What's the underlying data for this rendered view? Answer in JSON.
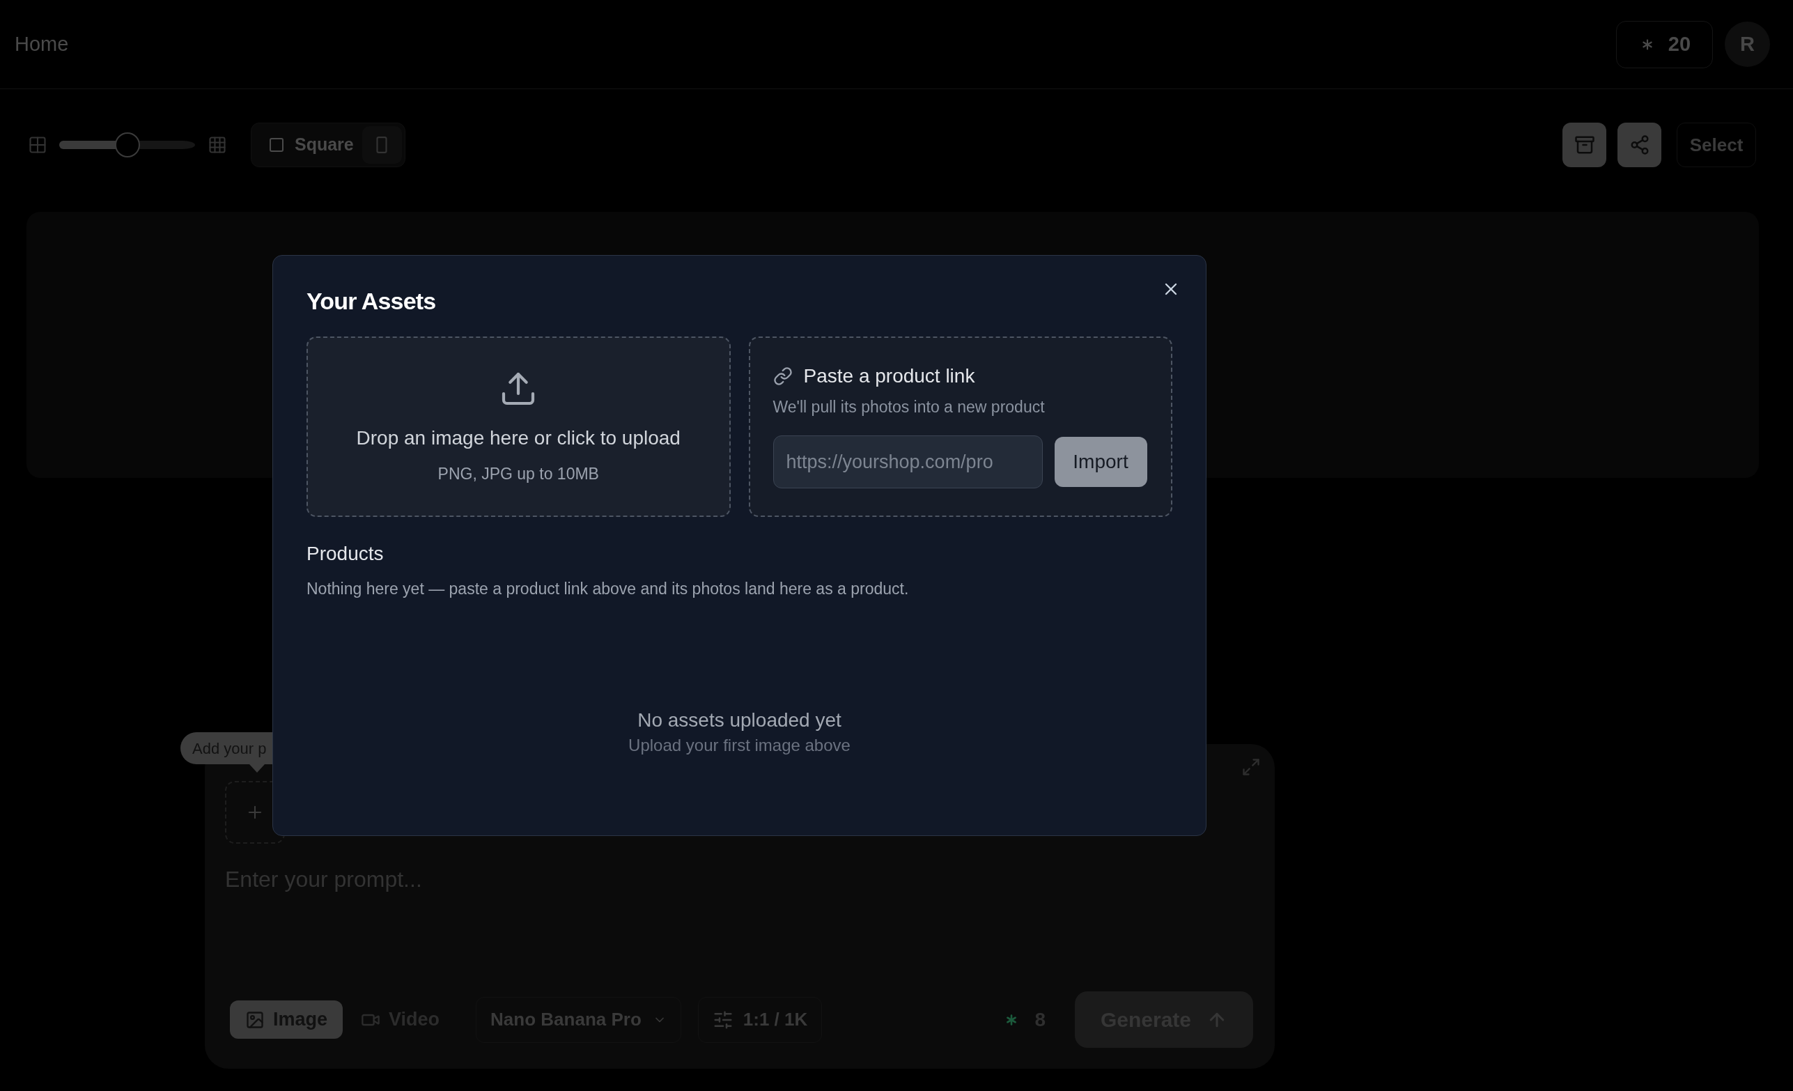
{
  "header": {
    "title": "Home",
    "credits": "20",
    "avatar_initial": "R"
  },
  "toolbar": {
    "zoom_slider": {
      "level": 0.5
    },
    "aspect_button": "Square",
    "select_button": "Select"
  },
  "prompt_panel": {
    "tooltip": "Add your p",
    "prompt_input": {
      "placeholder": "Enter your prompt..."
    },
    "modes": [
      {
        "kind": "image",
        "label": "Image",
        "selected": true
      },
      {
        "kind": "video",
        "label": "Video",
        "selected": false
      }
    ],
    "model": "Nano Banana Pro",
    "settings": "1:1 / 1K",
    "cost": "8",
    "generate_button": "Generate"
  },
  "dialog": {
    "title": "Your Assets",
    "upload": {
      "text": "Drop an image here or click to upload",
      "hint": "PNG, JPG up to 10MB"
    },
    "link_import": {
      "title": "Paste a product link",
      "subtitle": "We'll pull its photos into a new product",
      "url_input": {
        "placeholder": "https://yourshop.com/pro"
      },
      "button": "Import"
    },
    "products": {
      "title": "Products",
      "empty_text": "Nothing here yet — paste a product link above and its photos land here as a product."
    },
    "empty_state": {
      "title": "No assets uploaded yet",
      "subtitle": "Upload your first image above"
    }
  }
}
